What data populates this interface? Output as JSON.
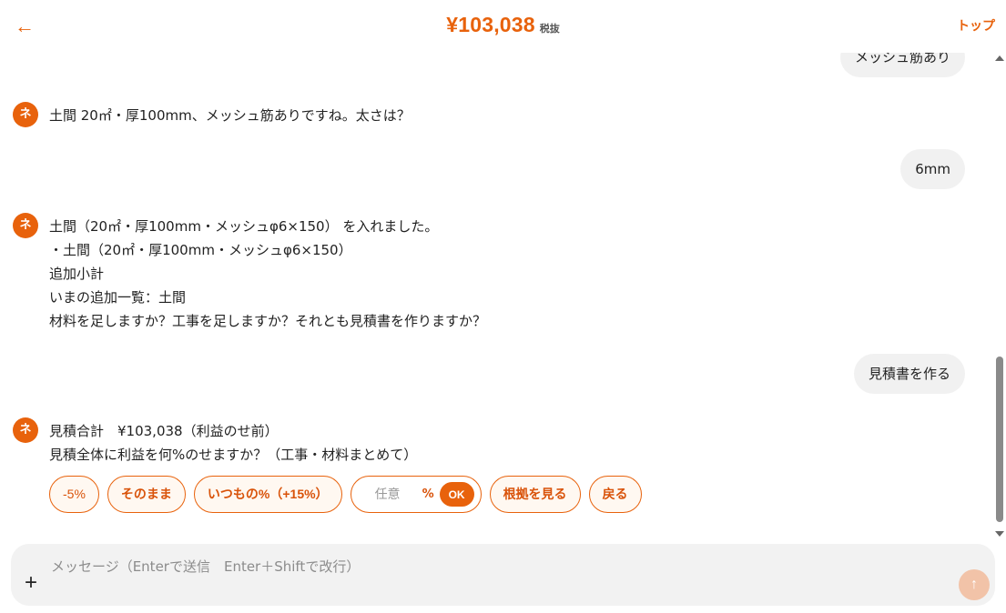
{
  "header": {
    "back_icon": "←",
    "total_amount": "¥103,038",
    "tax_label": "税抜",
    "top_link": "トップ"
  },
  "bot_avatar_label": "ネ",
  "messages": {
    "user_1": "メッシュ筋あり",
    "bot_1": [
      "土間 20㎡・厚100mm、メッシュ筋ありですね。太さは？"
    ],
    "user_2": "6mm",
    "bot_2": [
      "土間（20㎡・厚100mm・メッシュφ6×150） を入れました。",
      "・土間（20㎡・厚100mm・メッシュφ6×150）",
      "追加小計",
      "いまの追加一覧：土間",
      "材料を足しますか？工事を足しますか？それとも見積書を作りますか？"
    ],
    "user_3": "見積書を作る",
    "bot_3": [
      "見積合計　¥103,038（利益のせ前）",
      "見積全体に利益を何%のせますか？（工事・材料まとめて）"
    ]
  },
  "choices": {
    "minus5": "-5%",
    "asis": "そのまま",
    "usual": "いつもの%（+15%）",
    "custom_placeholder": "任意",
    "custom_unit": "%",
    "ok": "OK",
    "basis": "根拠を見る",
    "back": "戻る"
  },
  "composer": {
    "placeholder": "メッセージ（Enterで送信　Enter＋Shiftで改行）",
    "plus_icon": "+",
    "send_icon": "↑"
  },
  "colors": {
    "accent": "#e8620c",
    "chip_bg": "#fff8f1",
    "user_bubble": "#f1f1f1",
    "composer_bg": "#f2f2f2",
    "send_disabled": "#f2c3a8"
  }
}
